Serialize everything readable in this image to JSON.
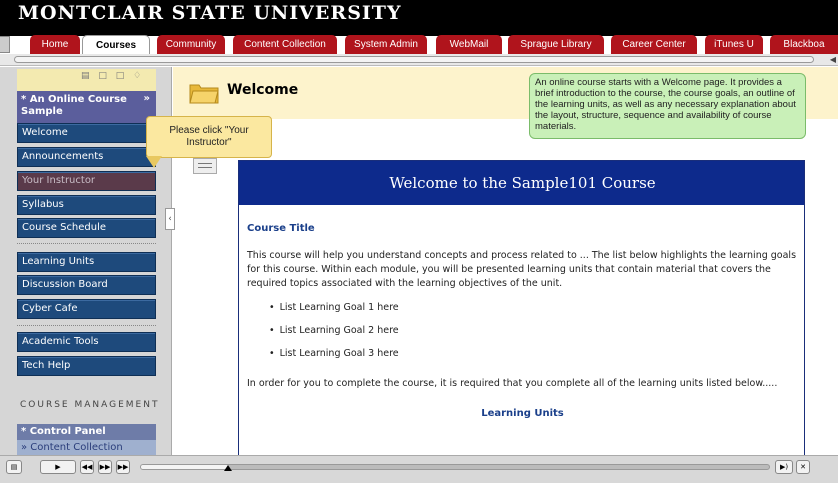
{
  "banner": {
    "title": "MONTCLAIR STATE UNIVERSITY"
  },
  "tabs": [
    {
      "label": "Home",
      "active": false
    },
    {
      "label": "Courses",
      "active": true
    },
    {
      "label": "Community",
      "active": false
    },
    {
      "label": "Content Collection",
      "active": false
    },
    {
      "label": "System Admin",
      "active": false
    },
    {
      "label": "WebMail",
      "active": false
    },
    {
      "label": "Sprague Library",
      "active": false
    },
    {
      "label": "Career Center",
      "active": false
    },
    {
      "label": "iTunes U",
      "active": false
    },
    {
      "label": "Blackboa",
      "active": false
    }
  ],
  "sidebar": {
    "course_name": "* An Online Course Sample",
    "items": [
      {
        "label": "Welcome"
      },
      {
        "label": "Announcements"
      },
      {
        "label": "Your Instructor"
      },
      {
        "label": "Syllabus"
      },
      {
        "label": "Course Schedule"
      },
      {
        "label": "Learning Units"
      },
      {
        "label": "Discussion Board"
      },
      {
        "label": "Cyber Cafe"
      },
      {
        "label": "Academic Tools"
      },
      {
        "label": "Tech Help"
      }
    ],
    "management_label": "COURSE MANAGEMENT",
    "control_panel": "* Control Panel",
    "control_item": "» Content Collection"
  },
  "tooltip": {
    "text": "Please click \"Your Instructor\""
  },
  "main": {
    "page_title": "Welcome",
    "note": "An online course starts with a Welcome page. It provides a brief introduction to the course, the course goals, an outline of the learning units, as well as any necessary explanation about the layout, structure, sequence and availability of course materials.",
    "content_header": "Welcome to the Sample101 Course",
    "course_title_heading": "Course Title",
    "intro": "This course will help you understand concepts and process related to ... The list below highlights the learning goals for this course. Within each module, you will be presented learning units that contain material that covers the required topics associated with the learning objectives of the unit.",
    "goals": [
      "List Learning Goal 1 here",
      "List Learning Goal 2 here",
      "List Learning Goal 3 here"
    ],
    "completion": "In order for you to complete the course, it is required that you complete all of the learning units listed below.....",
    "learning_units_heading": "Learning Units"
  },
  "player": {
    "progress": 0.14
  }
}
